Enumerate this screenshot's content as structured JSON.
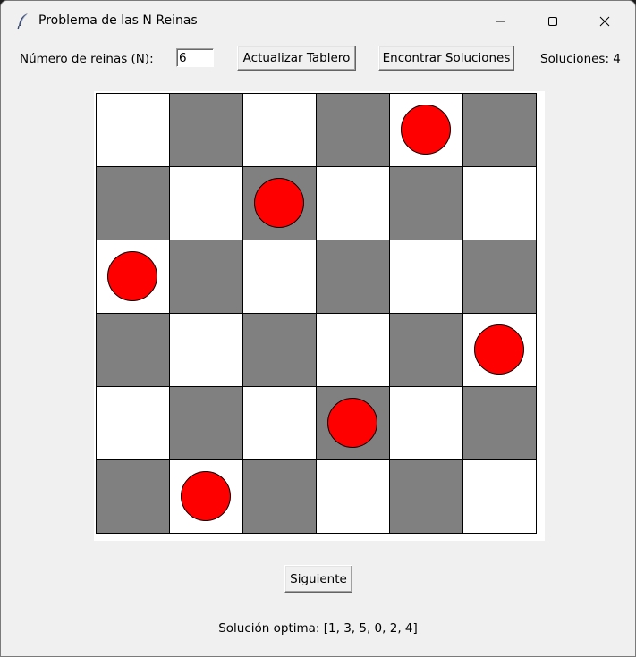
{
  "window": {
    "title": "Problema de las N Reinas",
    "icon": "feather-icon",
    "controls": [
      "minimize-icon",
      "maximize-icon",
      "close-icon"
    ]
  },
  "toolbar": {
    "n_label": "Número de reinas (N):",
    "n_value": "6",
    "update_label": "Actualizar Tablero",
    "find_label": "Encontrar Soluciones",
    "count_label": "Soluciones: 4"
  },
  "board": {
    "size": 6,
    "queens": [
      4,
      2,
      0,
      5,
      3,
      1
    ],
    "colors": {
      "light": "#ffffff",
      "dark": "#808080",
      "queen": "#ff0000"
    }
  },
  "footer": {
    "next_label": "Siguiente",
    "solution_text": "Solución optima: [1, 3, 5, 0, 2, 4]"
  }
}
